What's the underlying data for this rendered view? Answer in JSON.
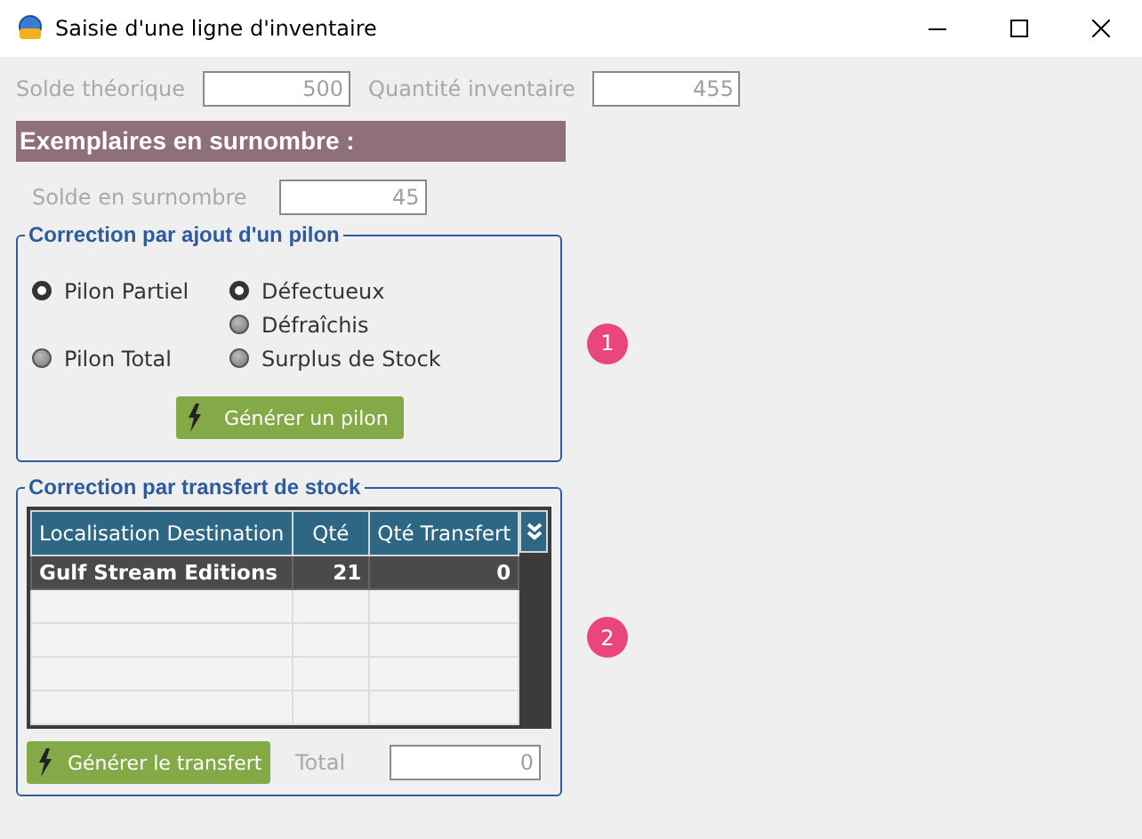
{
  "window": {
    "title": "Saisie d'une ligne d'inventaire"
  },
  "summary": [
    {
      "label": "Solde théorique",
      "value": "500"
    },
    {
      "label": "Quantité inventaire",
      "value": "455"
    }
  ],
  "section_header": "Exemplaires en surnombre :",
  "surplus": {
    "label": "Solde en surnombre",
    "value": "45"
  },
  "pilon_group": {
    "title": "Correction par ajout d'un pilon",
    "type_options": [
      {
        "label": "Pilon Partiel",
        "selected": true
      },
      {
        "label": "Pilon Total",
        "selected": false
      }
    ],
    "reason_options": [
      {
        "label": "Défectueux",
        "selected": true
      },
      {
        "label": "Défraîchis",
        "selected": false
      },
      {
        "label": "Surplus de Stock",
        "selected": false
      }
    ],
    "button": "Générer un pilon",
    "badge": "1"
  },
  "transfer_group": {
    "title": "Correction par transfert de stock",
    "table": {
      "columns": [
        "Localisation Destination",
        "Qté",
        "Qté Transfert"
      ],
      "rows": [
        {
          "cells": [
            "Gulf Stream Editions",
            "21",
            "0"
          ],
          "selected": true
        }
      ]
    },
    "button": "Générer le transfert",
    "total": {
      "label": "Total",
      "value": "0"
    },
    "badge": "2"
  }
}
